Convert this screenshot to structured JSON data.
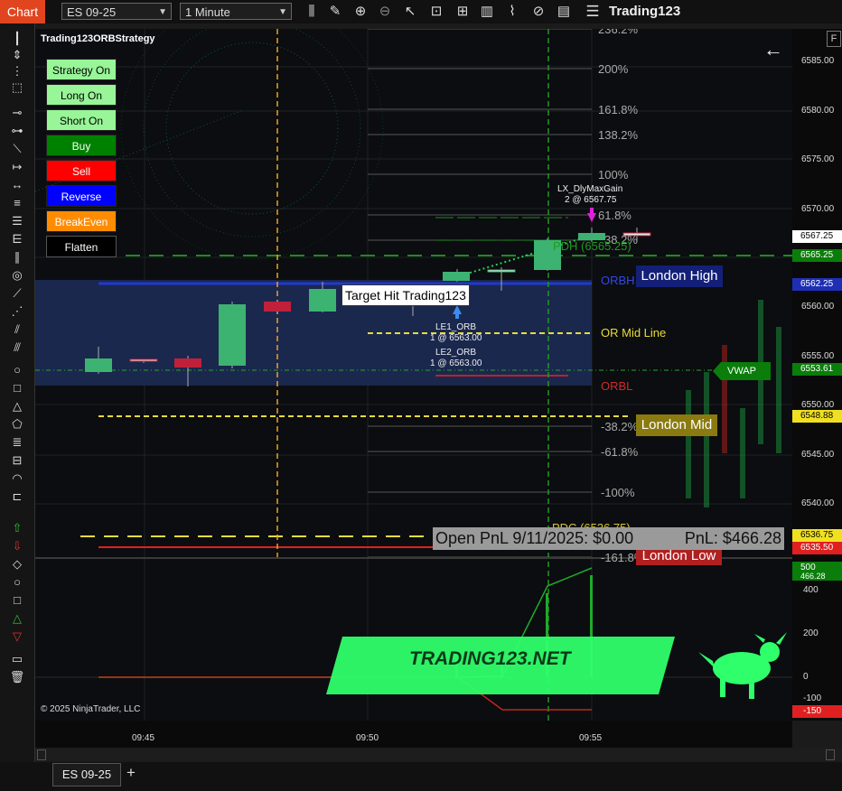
{
  "toolbar": {
    "chart_tab": "Chart",
    "instrument": "ES 09-25",
    "interval": "1 Minute",
    "title": "Trading123",
    "icons": [
      "bar-type-icon",
      "draw-pencil-icon",
      "zoom-in-icon",
      "zoom-out-icon",
      "pointer-icon",
      "data-box-icon",
      "chart-style-icon",
      "indicators-icon",
      "strategies-icon",
      "properties-icon",
      "menu-icon"
    ]
  },
  "strategy": {
    "name": "Trading123ORBStrategy",
    "buttons": [
      {
        "label": "Strategy On",
        "bg": "#98f598",
        "fg": "#000000"
      },
      {
        "label": "Long On",
        "bg": "#98f598",
        "fg": "#000000"
      },
      {
        "label": "Short On",
        "bg": "#98f598",
        "fg": "#000000"
      },
      {
        "label": "Buy",
        "bg": "#008000",
        "fg": "#ffffff"
      },
      {
        "label": "Sell",
        "bg": "#ff0000",
        "fg": "#ffffff"
      },
      {
        "label": "Reverse",
        "bg": "#0000ff",
        "fg": "#ffffff"
      },
      {
        "label": "BreakEven",
        "bg": "#ff8c00",
        "fg": "#ffffff"
      },
      {
        "label": "Flatten",
        "bg": "#000000",
        "fg": "#ffffff"
      }
    ]
  },
  "fib_labels": [
    "236.2%",
    "200%",
    "161.8%",
    "138.2%",
    "100%",
    "61.8%",
    "38.2%",
    "-38.2%",
    "-61.8%",
    "-100%",
    "-161.8%"
  ],
  "labels": {
    "london_high": "London High",
    "london_mid": "London Mid",
    "london_low": "London Low",
    "orbh": "ORBH",
    "orbl": "ORBL",
    "or_mid": "OR Mid Line",
    "pdh": "PDH (6565.25)",
    "pdc": "PDC (6536.75)",
    "vwap": "VWAP",
    "target_hit": "Target Hit Trading123",
    "le1": "LE1_ORB",
    "le1_fill": "1 @ 6563.00",
    "le2": "LE2_ORB",
    "le2_fill": "1 @ 6563.00",
    "lx": "LX_DlyMaxGain",
    "lx_fill": "2 @ 6567.75",
    "pnl_open": "Open PnL 9/11/2025: $0.00",
    "pnl": "PnL: $466.28",
    "watermark": "TRADING123.NET",
    "copyright": "© 2025 NinjaTrader, LLC",
    "f_button": "F"
  },
  "price_ticks": [
    "6585.00",
    "6580.00",
    "6575.00",
    "6570.00",
    "6560.00",
    "6555.00",
    "6550.00",
    "6545.00",
    "6540.00"
  ],
  "price_tags": [
    {
      "text": "6567.25",
      "bg": "#ffffff",
      "fg": "#000000"
    },
    {
      "text": "6565.25",
      "bg": "#0a7d0a",
      "fg": "#ffffff"
    },
    {
      "text": "6562.25",
      "bg": "#1f2fb5",
      "fg": "#ffffff"
    },
    {
      "text": "6553.61",
      "bg": "#0a7d0a",
      "fg": "#ffffff"
    },
    {
      "text": "6548.88",
      "bg": "#f0e020",
      "fg": "#000000"
    },
    {
      "text": "6536.75",
      "bg": "#f0e020",
      "fg": "#000000"
    },
    {
      "text": "6535.50",
      "bg": "#e02020",
      "fg": "#ffffff"
    }
  ],
  "pnl_axis": {
    "ticks": [
      "400",
      "200",
      "0",
      "-100"
    ],
    "tags": [
      {
        "text": "500",
        "bg": "#0a7d0a",
        "fg": "#ffffff"
      },
      {
        "text": "466.28",
        "bg": "#0a7d0a",
        "fg": "#ffffff"
      },
      {
        "text": "-150",
        "bg": "#e02020",
        "fg": "#ffffff"
      }
    ]
  },
  "time_ticks": [
    "09:45",
    "09:50",
    "09:55"
  ],
  "bottom": {
    "instrument_tab": "ES 09-25",
    "add_tab": "+"
  }
}
